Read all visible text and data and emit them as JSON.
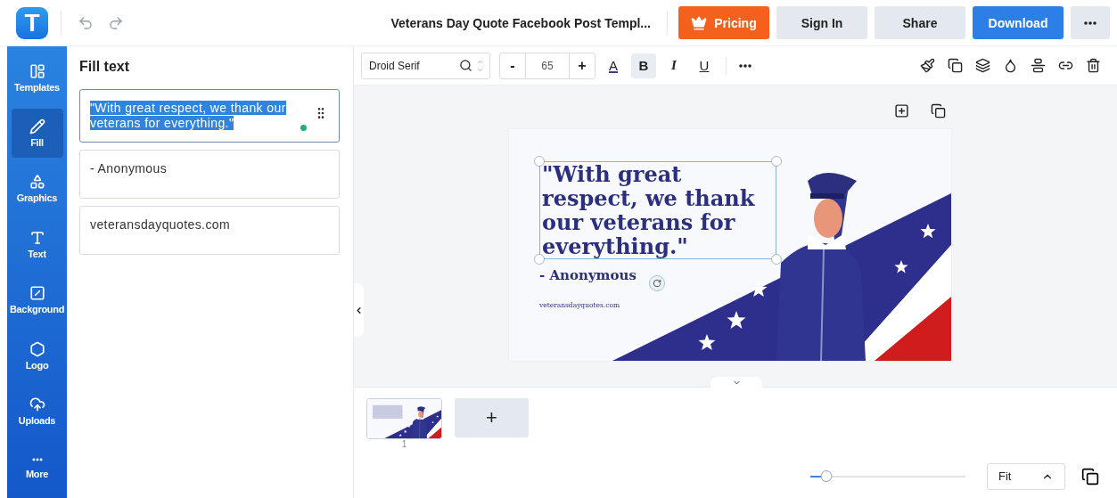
{
  "app": {
    "logo": "T"
  },
  "header": {
    "title": "Veterans Day Quote Facebook Post Templ...",
    "buttons": [
      {
        "label": "Pricing",
        "kind": "pricing"
      },
      {
        "label": "Sign In",
        "kind": "plain"
      },
      {
        "label": "Share",
        "kind": "plain"
      },
      {
        "label": "Download",
        "kind": "primary"
      }
    ]
  },
  "sidebar": {
    "items": [
      {
        "label": "Templates",
        "kind": "templates",
        "selected": false
      },
      {
        "label": "Fill",
        "kind": "fill",
        "selected": true
      },
      {
        "label": "Graphics",
        "kind": "graphics",
        "selected": false
      },
      {
        "label": "Text",
        "kind": "text",
        "selected": false
      },
      {
        "label": "Background",
        "kind": "background",
        "selected": false
      },
      {
        "label": "Logo",
        "kind": "logo",
        "selected": false
      },
      {
        "label": "Uploads",
        "kind": "uploads",
        "selected": false
      },
      {
        "label": "More",
        "kind": "more",
        "selected": false
      }
    ]
  },
  "fill_panel": {
    "title": "Fill text",
    "fields": [
      {
        "value": "\"With great respect, we thank our veterans for everything.\"",
        "selected": true
      },
      {
        "value": "- Anonymous",
        "selected": false
      },
      {
        "value": "veteransdayquotes.com",
        "selected": false
      }
    ]
  },
  "toolbar": {
    "font": "Droid Serif",
    "minus": "-",
    "size": "65",
    "plus": "+",
    "styles": [
      {
        "label": "A",
        "kind": "color",
        "selected": false
      },
      {
        "label": "B",
        "kind": "bold",
        "selected": true
      },
      {
        "label": "I",
        "kind": "italic",
        "selected": false
      },
      {
        "label": "U",
        "kind": "underline",
        "selected": false
      }
    ]
  },
  "design": {
    "quote": "\"With great respect, we thank our veterans for everything.\"",
    "author": "- Anonymous",
    "website": "veteransdayquotes.com"
  },
  "pages": {
    "thumbnails": [
      {
        "number": "1",
        "selected": true
      }
    ],
    "add": "+"
  },
  "zoom": {
    "level": 0.13,
    "mode": "Fit"
  }
}
